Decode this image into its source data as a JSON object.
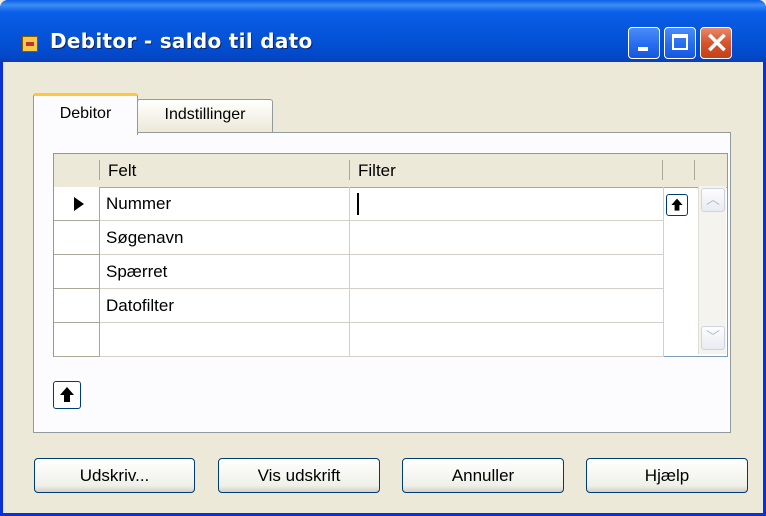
{
  "window": {
    "title": "Debitor - saldo til dato",
    "title_bar_color": "#0453d8",
    "close_color": "#d8522b"
  },
  "tabs": [
    {
      "label": "Debitor",
      "active": true
    },
    {
      "label": "Indstillinger",
      "active": false
    }
  ],
  "grid": {
    "columns": [
      "Felt",
      "Filter"
    ],
    "rows": [
      {
        "felt": "Nummer",
        "filter": "",
        "current": true
      },
      {
        "felt": "Søgenavn",
        "filter": ""
      },
      {
        "felt": "Spærret",
        "filter": ""
      },
      {
        "felt": "Datofilter",
        "filter": ""
      },
      {
        "felt": "",
        "filter": ""
      }
    ]
  },
  "icons": [
    "app-icon",
    "minimize-icon",
    "maximize-icon",
    "close-icon",
    "up-arrow-icon",
    "scroll-up-icon",
    "scroll-down-icon",
    "row-selector-arrow-icon"
  ],
  "buttons": {
    "print_label": "Udskriv...",
    "preview_label": "Vis udskrift",
    "cancel_label": "Annuller",
    "help_label": "Hjælp"
  }
}
